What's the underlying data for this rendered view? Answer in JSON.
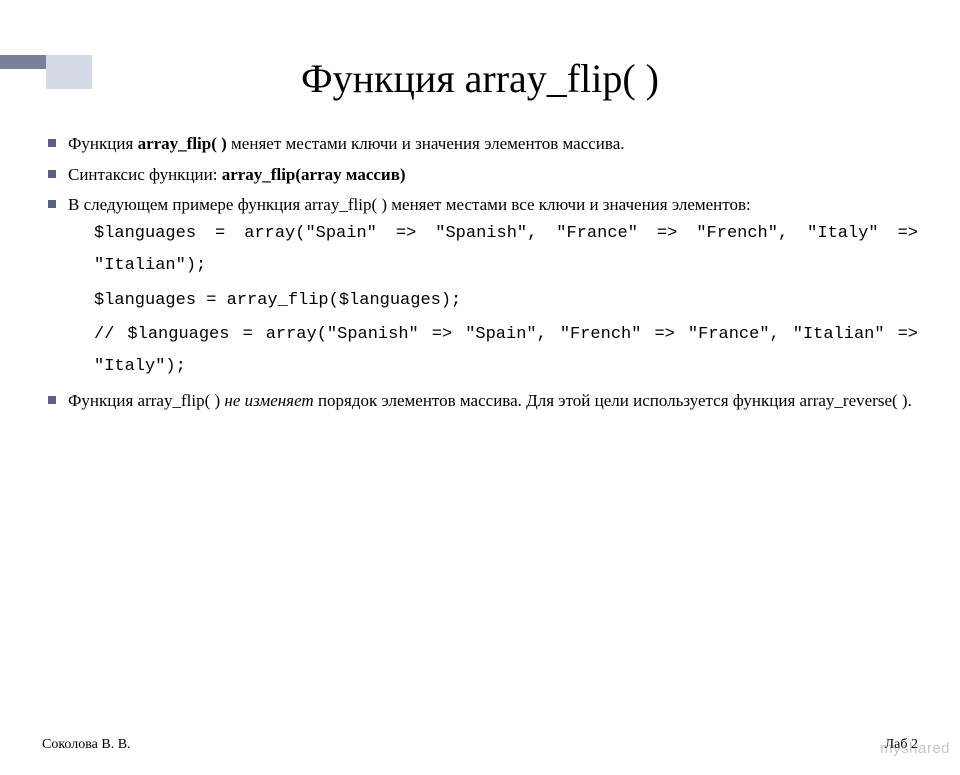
{
  "title": "Функция array_flip( )",
  "bullets": {
    "b1_pre": "Функция ",
    "b1_bold": "array_flip( )",
    "b1_post": " меняет местами ключи и значения элементов массива.",
    "b2_pre": "Синтаксис функции: ",
    "b2_bold": "array_flip(array массив)",
    "b3": "В следующем примере функция array_flip( ) меняет местами все ключи и значения элементов:",
    "b4_pre": "Функция array_flip( ) ",
    "b4_italic": "не изменяет",
    "b4_post": " порядок элементов массива. Для этой цели используется функция array_reverse( )."
  },
  "code": {
    "l1": "$languages = array(\"Spain\" => \"Spanish\", \"France\" => \"French\", \"Italy\" => \"Italian\");",
    "l2": "$languages = array_flip($languages);",
    "l3": "// $languages = array(\"Spanish\" => \"Spain\", \"French\" => \"France\", \"Italian\" => \"Italy\");"
  },
  "footer": {
    "left": "Соколова В. В.",
    "right": "Лаб 2"
  },
  "watermark": "myshared"
}
